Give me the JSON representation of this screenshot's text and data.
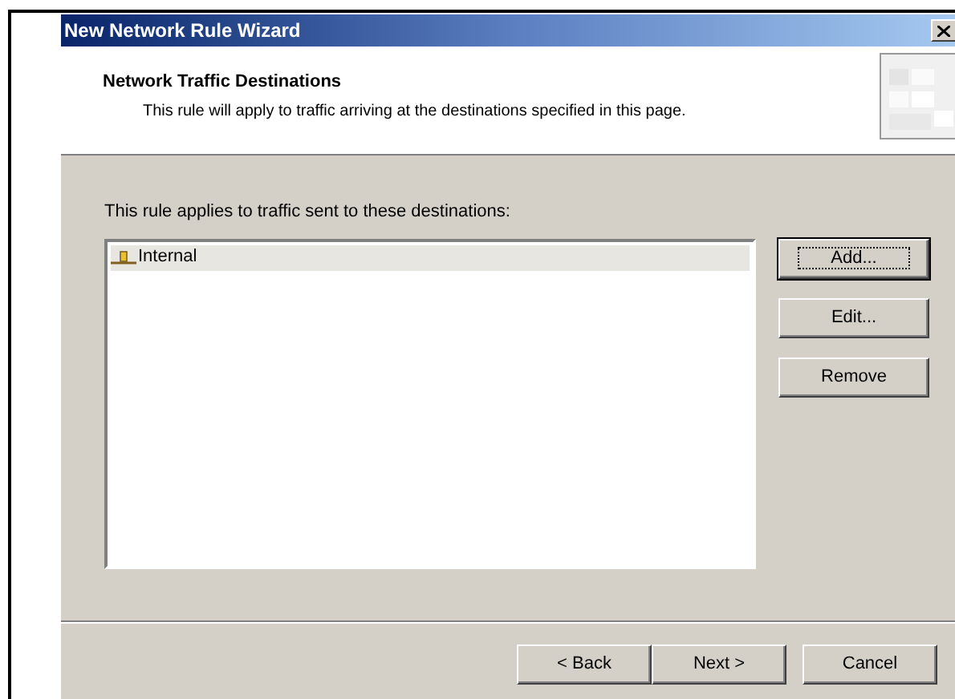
{
  "window": {
    "title": "New Network Rule Wizard"
  },
  "header": {
    "title": "Network Traffic Destinations",
    "subtitle": "This rule will apply to traffic arriving at the destinations specified in this page."
  },
  "instruction": "This rule applies to traffic sent to these destinations:",
  "destinations": [
    {
      "name": "Internal",
      "selected": true
    }
  ],
  "side_buttons": [
    {
      "label": "Add...",
      "focused": true
    },
    {
      "label": "Edit...",
      "focused": false
    },
    {
      "label": "Remove",
      "focused": false
    }
  ],
  "footer_buttons": [
    {
      "label": "< Back"
    },
    {
      "label": "Next >"
    },
    {
      "label": "Cancel"
    }
  ]
}
